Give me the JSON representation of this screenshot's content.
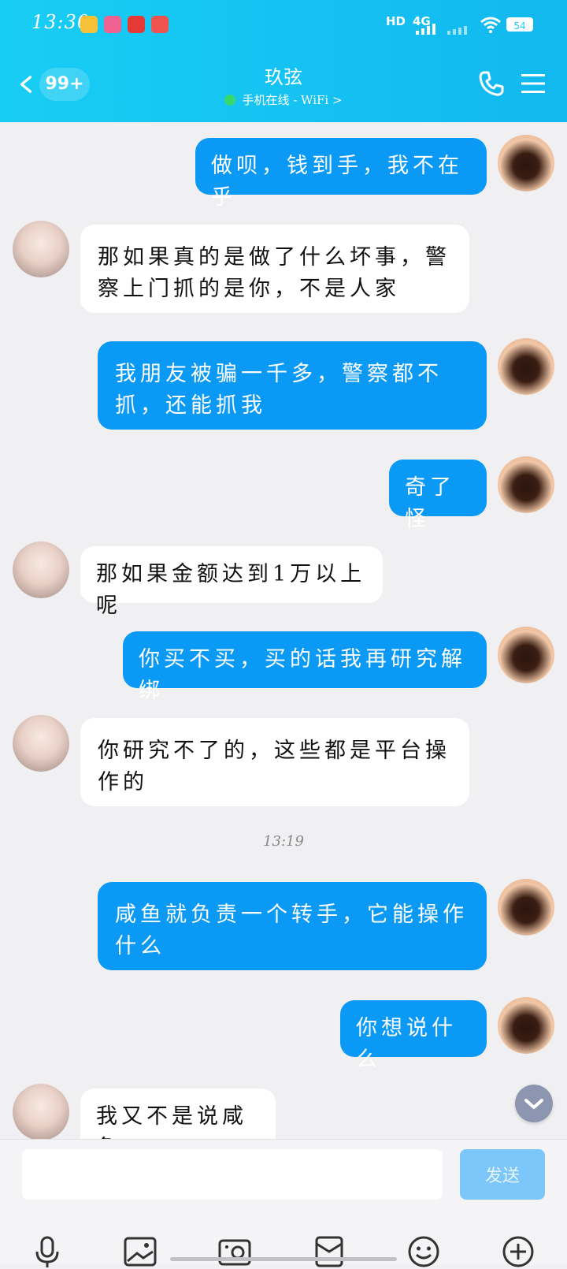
{
  "status_bar": {
    "time": "13:30",
    "network": "4G",
    "battery": "54"
  },
  "header": {
    "unread_badge": "99+",
    "contact_name": "玖弦",
    "contact_status": "手机在线 - WiFi >"
  },
  "messages": [
    {
      "sender": "self",
      "text": "做呗，钱到手，我不在乎"
    },
    {
      "sender": "other",
      "text": "那如果真的是做了什么坏事，警察上门抓的是你，不是人家"
    },
    {
      "sender": "self",
      "text": "我朋友被骗一千多，警察都不抓，还能抓我"
    },
    {
      "sender": "self",
      "text": "奇了怪"
    },
    {
      "sender": "other",
      "text": "那如果金额达到1万以上呢"
    },
    {
      "sender": "self",
      "text": "你买不买，买的话我再研究解绑"
    },
    {
      "sender": "other",
      "text": "你研究不了的，这些都是平台操作的"
    },
    {
      "sender": "self",
      "text": "咸鱼就负责一个转手，它能操作什么"
    },
    {
      "sender": "self",
      "text": "你想说什么"
    },
    {
      "sender": "other",
      "text": "我又不是说咸鱼"
    }
  ],
  "timestamp": "13:19",
  "input": {
    "placeholder": "",
    "send_label": "发送"
  },
  "colors": {
    "header": "#18cdf4",
    "self_bubble": "#0a99f5",
    "send_button": "#7cc6f9"
  }
}
